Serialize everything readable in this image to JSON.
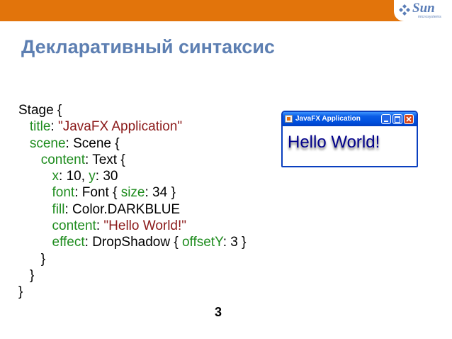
{
  "header": {
    "brand_color": "#e2740b",
    "logo": {
      "word": "Sun",
      "subtitle": "microsystems"
    }
  },
  "slide": {
    "title": "Декларативный синтаксис",
    "page_number": "3"
  },
  "code": {
    "colors": {
      "keyword": "#1e8c1e",
      "string": "#8b1a1a",
      "plain": "#000000"
    },
    "lines": [
      {
        "indent": "",
        "tokens": [
          {
            "t": "Stage {",
            "k": "plain"
          }
        ]
      },
      {
        "indent": "   ",
        "tokens": [
          {
            "t": "title",
            "k": "key"
          },
          {
            "t": ": ",
            "k": "plain"
          },
          {
            "t": "\"JavaFX Application\"",
            "k": "str"
          }
        ]
      },
      {
        "indent": "   ",
        "tokens": [
          {
            "t": "scene",
            "k": "key"
          },
          {
            "t": ": Scene {",
            "k": "plain"
          }
        ]
      },
      {
        "indent": "      ",
        "tokens": [
          {
            "t": "content",
            "k": "key"
          },
          {
            "t": ": Text {",
            "k": "plain"
          }
        ]
      },
      {
        "indent": "         ",
        "tokens": [
          {
            "t": "x",
            "k": "key"
          },
          {
            "t": ": 10, ",
            "k": "plain"
          },
          {
            "t": "y",
            "k": "key"
          },
          {
            "t": ": 30",
            "k": "plain"
          }
        ]
      },
      {
        "indent": "         ",
        "tokens": [
          {
            "t": "font",
            "k": "key"
          },
          {
            "t": ": Font { ",
            "k": "plain"
          },
          {
            "t": "size",
            "k": "key"
          },
          {
            "t": ": 34 }",
            "k": "plain"
          }
        ]
      },
      {
        "indent": "         ",
        "tokens": [
          {
            "t": "fill",
            "k": "key"
          },
          {
            "t": ": Color.DARKBLUE",
            "k": "plain"
          }
        ]
      },
      {
        "indent": "         ",
        "tokens": [
          {
            "t": "content",
            "k": "key"
          },
          {
            "t": ": ",
            "k": "plain"
          },
          {
            "t": "\"Hello World!\"",
            "k": "str"
          }
        ]
      },
      {
        "indent": "         ",
        "tokens": [
          {
            "t": "effect",
            "k": "key"
          },
          {
            "t": ": DropShadow { ",
            "k": "plain"
          },
          {
            "t": "offsetY",
            "k": "key"
          },
          {
            "t": ": 3 }",
            "k": "plain"
          }
        ]
      },
      {
        "indent": "      ",
        "tokens": [
          {
            "t": "}",
            "k": "plain"
          }
        ]
      },
      {
        "indent": "   ",
        "tokens": [
          {
            "t": "}",
            "k": "plain"
          }
        ]
      },
      {
        "indent": "",
        "tokens": [
          {
            "t": "}",
            "k": "plain"
          }
        ]
      }
    ]
  },
  "preview_window": {
    "title": "JavaFX Application",
    "content_text": "Hello World!",
    "text_color": "#00008b",
    "titlebar_color": "#0050de",
    "icons": [
      "app-icon",
      "minimize-icon",
      "maximize-icon",
      "close-icon"
    ]
  }
}
